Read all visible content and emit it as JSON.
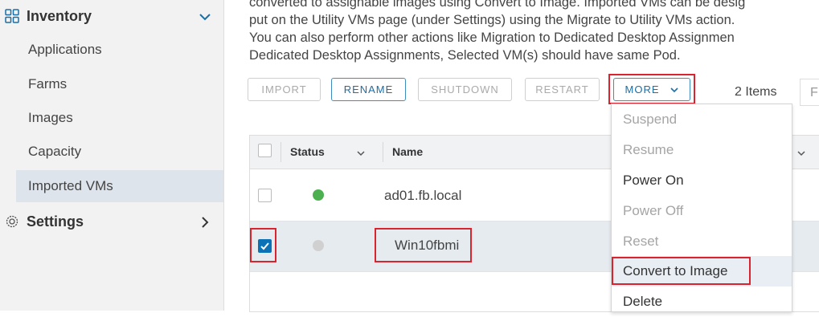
{
  "sidebar": {
    "inventory": {
      "label": "Inventory",
      "icon": "grid-icon"
    },
    "items": [
      {
        "label": "Applications"
      },
      {
        "label": "Farms"
      },
      {
        "label": "Images"
      },
      {
        "label": "Capacity"
      },
      {
        "label": "Imported VMs"
      }
    ],
    "settings": {
      "label": "Settings",
      "icon": "gear-icon"
    }
  },
  "description": {
    "lines": [
      "converted to assignable images using Convert to Image. Imported VMs can be desig",
      "put on the Utility VMs page (under Settings) using the Migrate to Utility VMs action.",
      "You can also perform other actions like Migration to Dedicated Desktop Assignmen",
      "Dedicated Desktop Assignments, Selected VM(s) should have same Pod."
    ]
  },
  "toolbar": {
    "import": "IMPORT",
    "rename": "RENAME",
    "shutdown": "SHUTDOWN",
    "restart": "RESTART",
    "more": "MORE",
    "item_count": "2 Items",
    "filter": "F"
  },
  "grid": {
    "headers": {
      "status": "Status",
      "name": "Name"
    },
    "rows": [
      {
        "name": "ad01.fb.local",
        "status_color": "#4caf50",
        "checked": false
      },
      {
        "name": "Win10fbmi",
        "status_color": "#d0d0d0",
        "checked": true
      }
    ]
  },
  "more_menu": {
    "items": [
      {
        "label": "Suspend",
        "enabled": false
      },
      {
        "label": "Resume",
        "enabled": false
      },
      {
        "label": "Power On",
        "enabled": true
      },
      {
        "label": "Power Off",
        "enabled": false
      },
      {
        "label": "Reset",
        "enabled": false
      },
      {
        "label": "Convert to Image",
        "enabled": true
      },
      {
        "label": "Delete",
        "enabled": true
      }
    ]
  },
  "colors": {
    "accent": "#0b72b5",
    "highlight": "#d9232e",
    "selected_row": "#e6ebf0"
  }
}
